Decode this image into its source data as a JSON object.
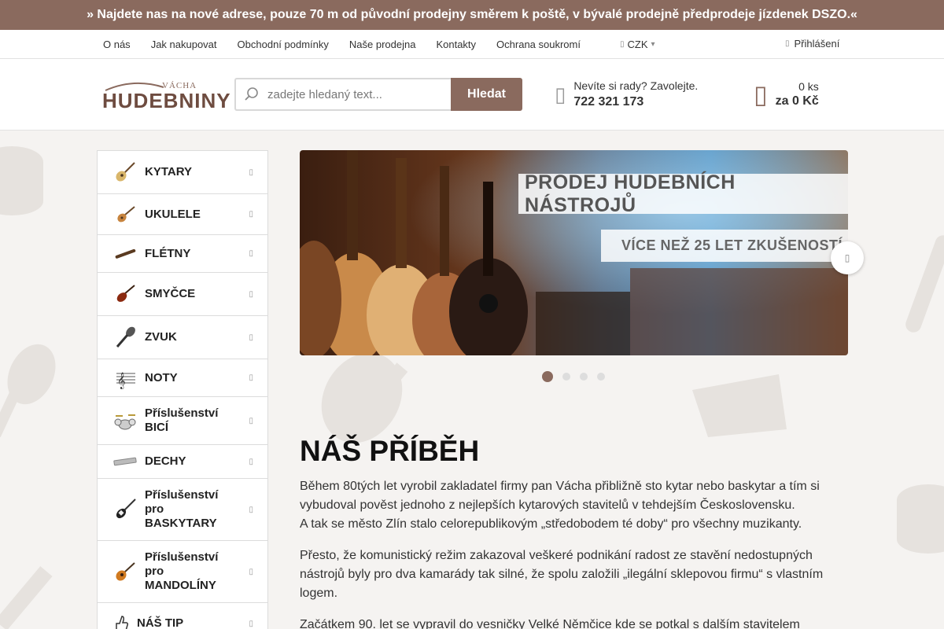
{
  "notice": "» Najdete nas na nové adrese, pouze 70 m od původní prodejny směrem k poště, v bývalé prodejně předprodeje jízdenek DSZO.«",
  "util_nav": {
    "links": [
      "O nás",
      "Jak nakupovat",
      "Obchodní podmínky",
      "Naše prodejna",
      "Kontakty",
      "Ochrana soukromí"
    ],
    "currency": "CZK",
    "login": "Přihlášení"
  },
  "header": {
    "logo_top": "VÁCHA",
    "logo_main": "HUDEBNINY",
    "search_placeholder": "zadejte hledaný text...",
    "search_button": "Hledat",
    "phone_label": "Nevíte si rady? Zavolejte.",
    "phone_number": "722 321 173",
    "cart_count": "0 ks",
    "cart_price": "za 0 Kč"
  },
  "categories": [
    {
      "label": "KYTARY",
      "icon": "guitar-icon"
    },
    {
      "label": "UKULELE",
      "icon": "ukulele-icon"
    },
    {
      "label": "FLÉTNY",
      "icon": "flute-icon"
    },
    {
      "label": "SMYČCE",
      "icon": "violin-icon"
    },
    {
      "label": "ZVUK",
      "icon": "microphone-icon"
    },
    {
      "label": "NOTY",
      "icon": "notes-icon"
    },
    {
      "label": "Příslušenství BICÍ",
      "icon": "drums-icon"
    },
    {
      "label": "DECHY",
      "icon": "harmonica-icon"
    },
    {
      "label": "Příslušenství pro BASKYTARY",
      "icon": "bass-guitar-icon"
    },
    {
      "label": "Příslušenství pro MANDOLÍNY",
      "icon": "mandolin-icon"
    },
    {
      "label": "NÁŠ TIP",
      "icon": "thumbs-up-icon"
    }
  ],
  "banner": {
    "title": "PRODEJ HUDEBNÍCH NÁSTROJŮ",
    "subtitle": "VÍCE NEŽ 25 LET ZKUŠENOSTÍ",
    "slides": 4,
    "active_slide": 1
  },
  "story": {
    "heading": "NÁŠ PŘÍBĚH",
    "p1a": "Během 80tých let vyrobil zakladatel firmy pan Vácha přibližně sto kytar nebo baskytar a tím si vybudoval pověst jednoho z nejlepších kytarových stavitelů v tehdejším Československu.",
    "p1b": "A tak se město Zlín stalo celorepublikovým „středobodem té doby“ pro všechny muzikanty.",
    "p2": "Přesto, že komunistický režim zakazoval veškeré podnikání radost ze stavění nedostupných nástrojů byly pro dva kamarády tak silné, že spolu založili „ilegální sklepovou firmu“ s vlastním logem.",
    "p3": "Začátkem 90. let se vypravil do vesničky Velké Němčice kde se potkal s dalším stavitelem"
  },
  "colors": {
    "brand": "#8a6a5e",
    "brand_dark": "#6e4c40"
  }
}
